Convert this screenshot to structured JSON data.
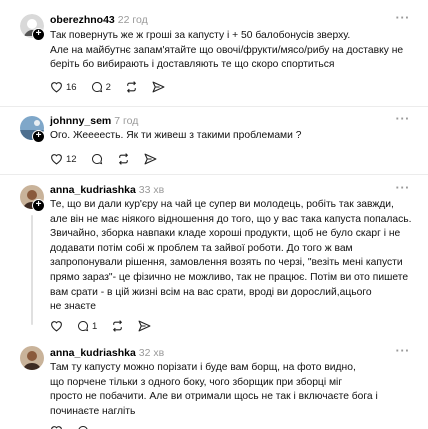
{
  "posts": [
    {
      "username": "oberezhno43",
      "time": "22 год",
      "lines": [
        "Так повернуть же ж гроші за капусту і + 50 балобонусів зверху.",
        "Але на майбутнє запам'ятайте що овочі/фрукти/мясо/рибу на доставку не",
        "беріть бо вибирають і доставляють те що скоро спортиться"
      ],
      "likes": "16",
      "replies": "2"
    },
    {
      "username": "johnny_sem",
      "time": "7 год",
      "lines": [
        "Ого. Жеееесть. Як ти живеш з такими проблемами ?"
      ],
      "likes": "12",
      "replies": ""
    },
    {
      "username": "anna_kudriashka",
      "time": "33 хв",
      "lines": [
        "Те, що ви дали кур'єру на чай це супер ви молодець, робіть так завжди,",
        "але він не має ніякого відношення до того, що у вас така капуста попалась.",
        "Звичайно, зборка навпаки кладе хороші продукти, щоб не було скарг і не",
        "додавати потім собі ж проблем та зайвої роботи. До того ж вам",
        "запропонували рішення, замовлення возять по черзі, \"везіть мені капусти",
        "прямо зараз\"- це фізично не можливо, так не працює. Потім ви ото пишете",
        "вам срати - в цій жизні всім на вас срати, вроді ви дорослий,ацього",
        "не знаєте"
      ],
      "likes": "",
      "replies": "1"
    },
    {
      "username": "anna_kudriashka",
      "time": "32 хв",
      "lines": [
        "Там ту капусту можно порізати і буде вам борщ, на фото видно,",
        "що порчене тільки з одного боку, чого зборщик при зборці міг",
        "просто не побачити. Але ви отримали щось не так і включаєте бога і",
        "починаєте нагліть"
      ],
      "likes": "",
      "replies": ""
    }
  ],
  "icons": {
    "like": "heart-icon",
    "reply": "comment-icon",
    "repost": "repost-icon",
    "share": "share-icon",
    "more": "more-icon",
    "follow": "plus-icon"
  }
}
